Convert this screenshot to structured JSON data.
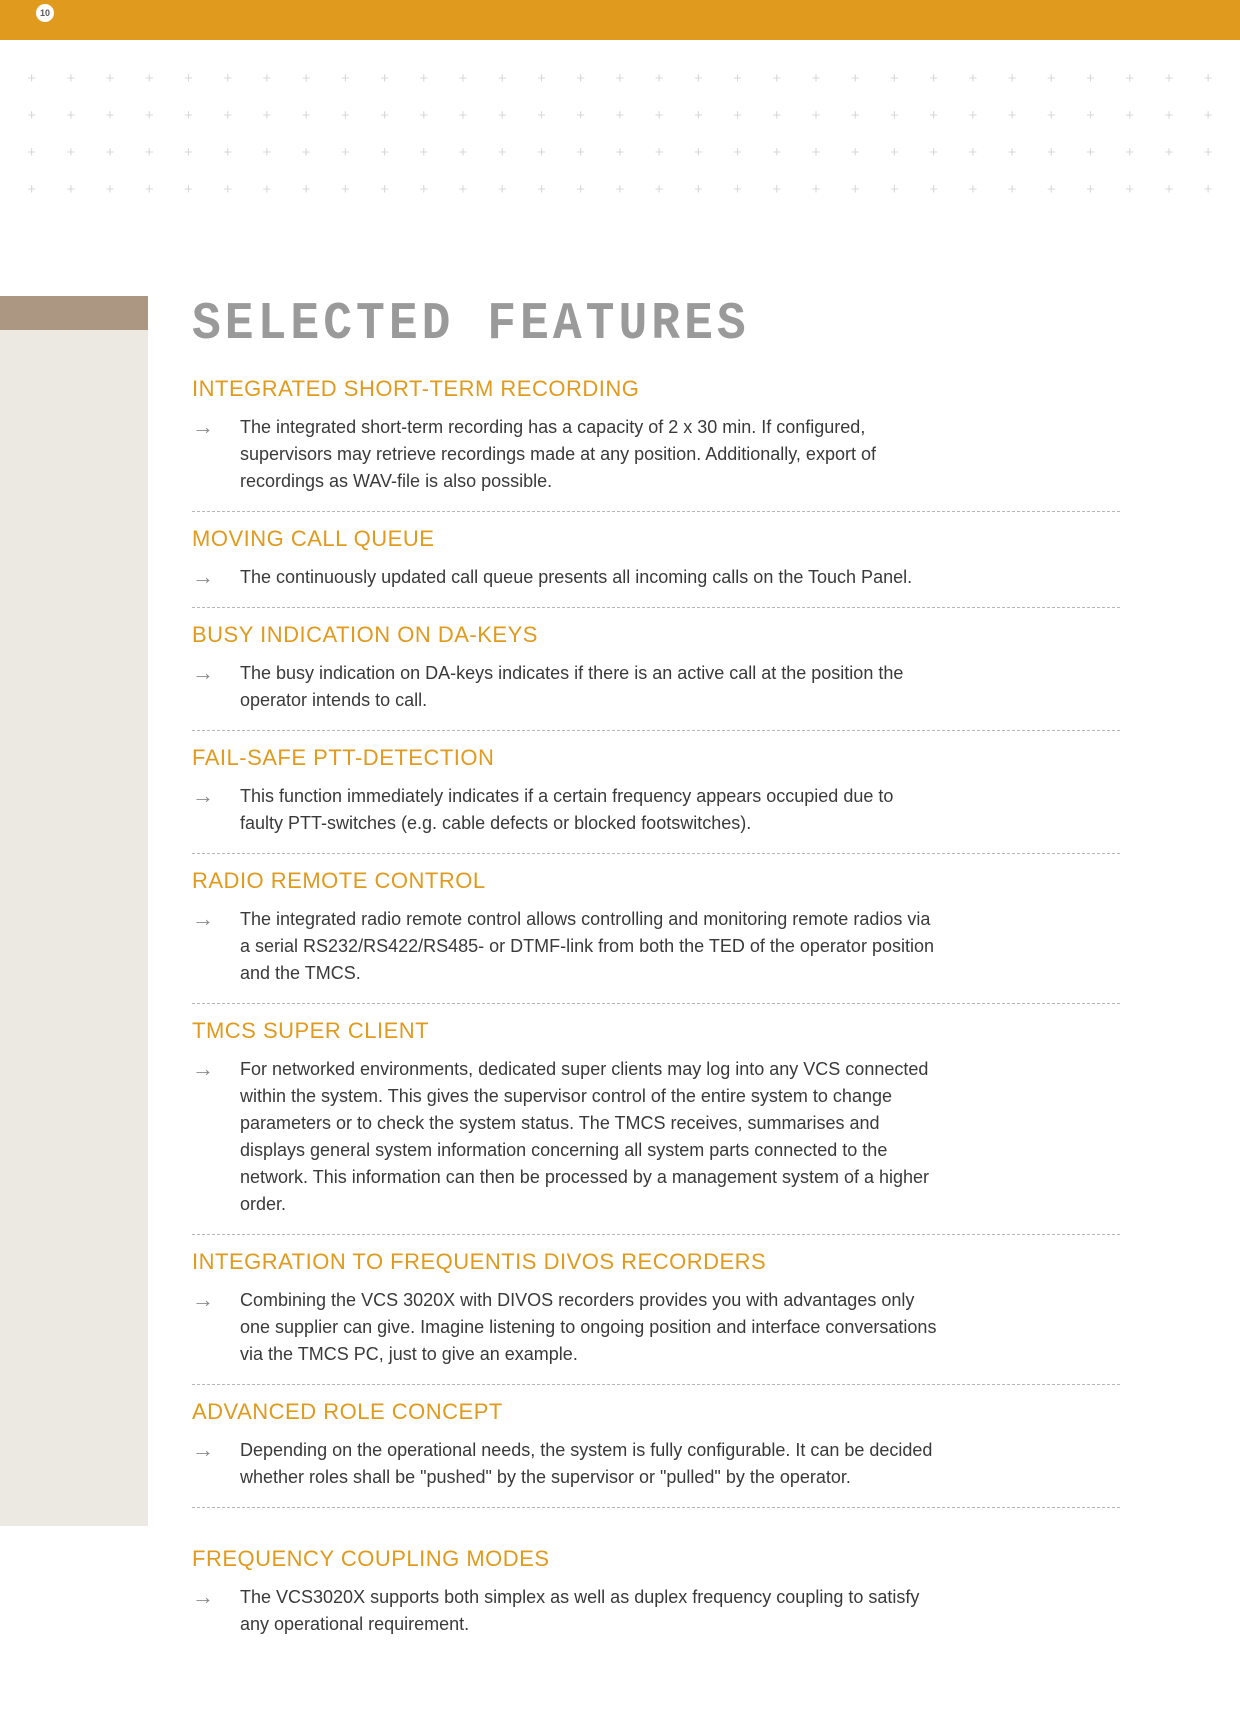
{
  "page_number": "10",
  "title": "SELECTED FEATURES",
  "arrow_glyph": "→",
  "sections": [
    {
      "heading": "INTEGRATED SHORT-TERM RECORDING",
      "body": "The integrated short-term recording has a capacity of 2 x 30 min. If configured, supervisors may retrieve recordings made at any position. Additionally, export of recordings as WAV-file is also possible."
    },
    {
      "heading": "MOVING CALL QUEUE",
      "body": "The continuously updated call queue presents all incoming calls on the Touch Panel."
    },
    {
      "heading": "BUSY INDICATION ON DA-KEYS",
      "body": "The busy indication on DA-keys indicates if there is an active call at the position the operator intends to call."
    },
    {
      "heading": "FAIL-SAFE PTT-DETECTION",
      "body": "This function immediately indicates if a certain frequency appears occupied due to faulty PTT-switches (e.g. cable defects or blocked footswitches)."
    },
    {
      "heading": "RADIO REMOTE CONTROL",
      "body": "The integrated radio remote control allows controlling and monitoring remote radios via a serial RS232/RS422/RS485- or DTMF-link from both the TED of the operator position and the TMCS."
    },
    {
      "heading": "TMCS SUPER CLIENT",
      "body": "For networked environments, dedicated super clients may log into any VCS connected within the system. This gives the supervisor control of the entire system to change parameters or to check the system status. The TMCS receives, summarises and displays general system information concerning all system parts connected to the network. This information can then be processed by a management system of a higher order."
    },
    {
      "heading": "INTEGRATION TO FREQUENTIS DIVOS RECORDERS",
      "body": "Combining the VCS 3020X with DIVOS recorders provides you with advantages only one supplier can give. Imagine listening to ongoing position and interface conversations via the TMCS PC, just to give an example."
    },
    {
      "heading": "ADVANCED ROLE CONCEPT",
      "body": "Depending on the operational needs, the system is fully configurable. It can be decided whether roles shall be \"pushed\" by the supervisor or \"pulled\" by the operator."
    },
    {
      "heading": "FREQUENCY COUPLING MODES",
      "body": "The VCS3020X supports both simplex as well as duplex frequency coupling to satisfy any operational requirement."
    }
  ]
}
